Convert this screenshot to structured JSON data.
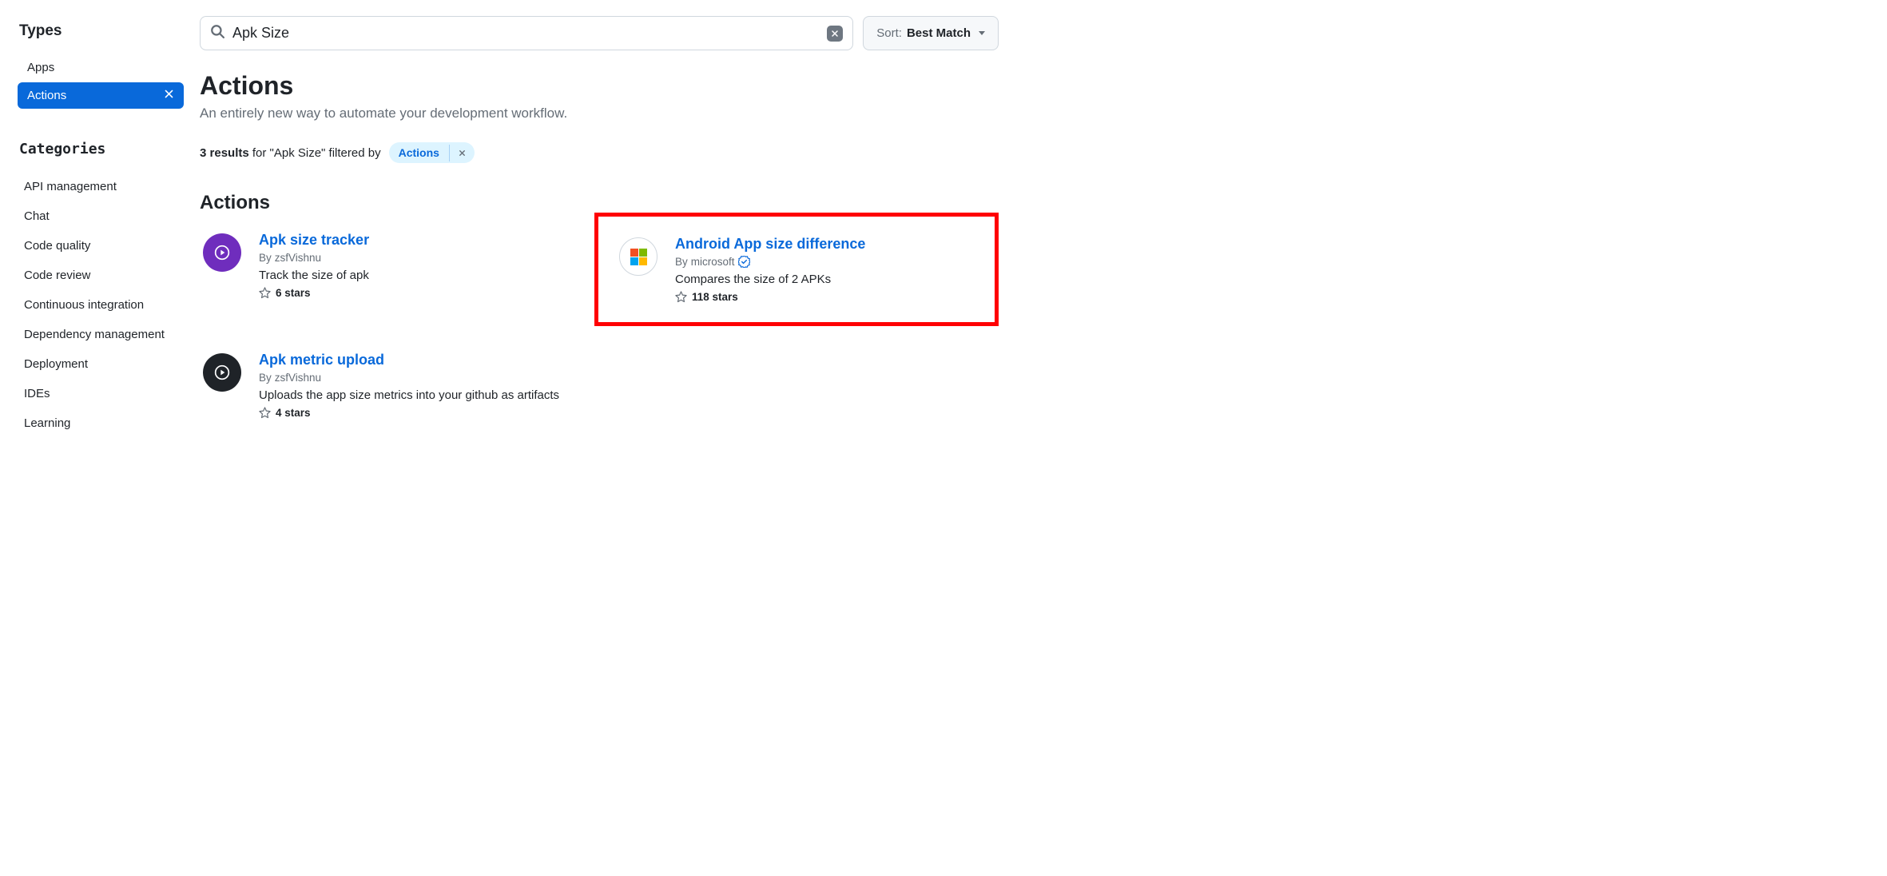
{
  "sidebar": {
    "types_heading": "Types",
    "categories_heading": "Categories",
    "type_items": [
      {
        "label": "Apps",
        "active": false
      },
      {
        "label": "Actions",
        "active": true
      }
    ],
    "category_items": [
      {
        "label": "API management"
      },
      {
        "label": "Chat"
      },
      {
        "label": "Code quality"
      },
      {
        "label": "Code review"
      },
      {
        "label": "Continuous integration"
      },
      {
        "label": "Dependency management"
      },
      {
        "label": "Deployment"
      },
      {
        "label": "IDEs"
      },
      {
        "label": "Learning"
      }
    ]
  },
  "search": {
    "value": "Apk Size",
    "sort_label": "Sort:",
    "sort_value": "Best Match"
  },
  "header": {
    "title": "Actions",
    "subtitle": "An entirely new way to automate your development workflow."
  },
  "results": {
    "count_text": "3 results",
    "middle_text": " for \"Apk Size\" filtered by ",
    "chip_label": "Actions"
  },
  "section_title": "Actions",
  "cards": [
    {
      "title": "Apk size tracker",
      "by_prefix": "By ",
      "author": "zsfVishnu",
      "verified": false,
      "desc": "Track the size of apk",
      "stars": "6 stars",
      "avatar_style": "purple",
      "highlighted": false
    },
    {
      "title": "Android App size difference",
      "by_prefix": "By ",
      "author": "microsoft",
      "verified": true,
      "desc": "Compares the size of 2 APKs",
      "stars": "118 stars",
      "avatar_style": "white_ms",
      "highlighted": true
    },
    {
      "title": "Apk metric upload",
      "by_prefix": "By ",
      "author": "zsfVishnu",
      "verified": false,
      "desc": "Uploads the app size metrics into your github as artifacts",
      "stars": "4 stars",
      "avatar_style": "dark",
      "highlighted": false
    }
  ]
}
